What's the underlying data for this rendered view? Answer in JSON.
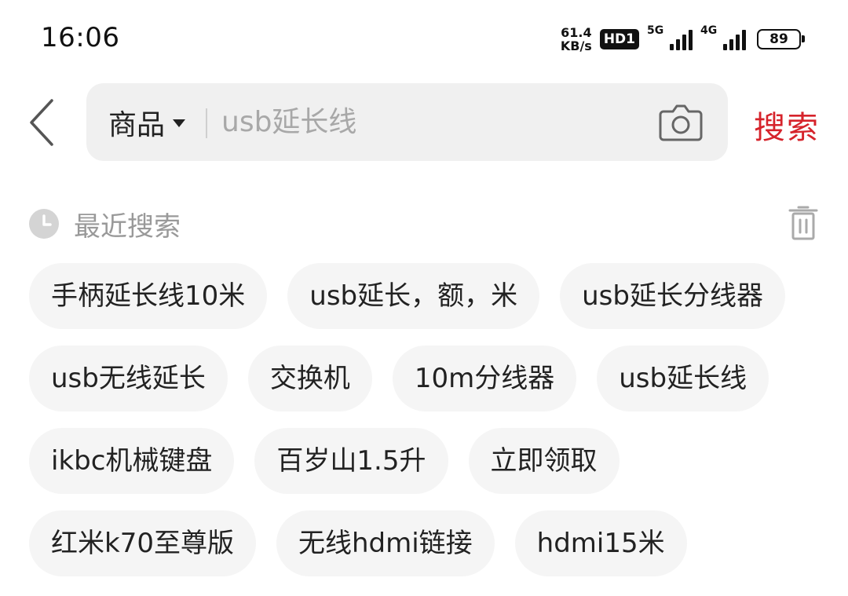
{
  "status_bar": {
    "time": "16:06",
    "speed_value": "61.4",
    "speed_unit": "KB/s",
    "hd_badge": "HD1",
    "signal_1_label": "5G",
    "signal_2_label": "4G",
    "battery": "89"
  },
  "search": {
    "scope_label": "商品",
    "placeholder": "usb延长线",
    "value": "",
    "search_button": "搜索"
  },
  "recent": {
    "title": "最近搜索",
    "rows": [
      [
        "手柄延长线10米",
        "usb延长，额，米",
        "usb延长分线器"
      ],
      [
        "usb无线延长",
        "交换机",
        "10m分线器",
        "usb延长线"
      ],
      [
        "ikbc机械键盘",
        "百岁山1.5升",
        "立即领取"
      ],
      [
        "红米k70至尊版",
        "无线hdmi链接",
        "hdmi15米"
      ]
    ]
  },
  "colors": {
    "accent": "#d6232b",
    "tag_bg": "#f5f5f5",
    "search_bg": "#f0f0f0",
    "muted_text": "#999999"
  },
  "icons": {
    "back": "chevron-left-icon",
    "camera": "camera-icon",
    "clock": "clock-icon",
    "trash": "trash-icon",
    "caret": "caret-down-icon"
  }
}
